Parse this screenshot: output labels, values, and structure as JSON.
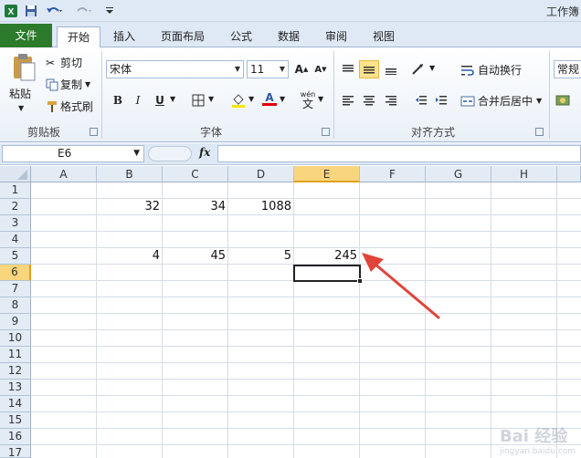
{
  "app": {
    "title": "工作簿"
  },
  "tabs": [
    "文件",
    "开始",
    "插入",
    "页面布局",
    "公式",
    "数据",
    "审阅",
    "视图"
  ],
  "clipboard": {
    "paste": "粘贴",
    "cut": "剪切",
    "copy": "复制",
    "format_painter": "格式刷",
    "group": "剪贴板"
  },
  "font": {
    "name": "宋体",
    "size": "11",
    "bold": "B",
    "italic": "I",
    "underline": "U",
    "wen": "wén",
    "wen_char": "文",
    "font_color_letter": "A",
    "group": "字体"
  },
  "alignment": {
    "wrap_text": "自动换行",
    "merge_center": "合并后居中",
    "group": "对齐方式"
  },
  "number": {
    "format": "常规"
  },
  "formula_bar": {
    "name_box": "E6",
    "fx": "fx",
    "content": ""
  },
  "sheet": {
    "columns": [
      "A",
      "B",
      "C",
      "D",
      "E",
      "F",
      "G",
      "H"
    ],
    "rows": [
      "1",
      "2",
      "3",
      "4",
      "5",
      "6",
      "7",
      "8",
      "9",
      "10",
      "11",
      "12",
      "13",
      "14",
      "15",
      "16",
      "17"
    ],
    "selected_cell": "E6",
    "cells": {
      "B2": "32",
      "C2": "34",
      "D2": "1088",
      "B5": "4",
      "C5": "45",
      "D5": "5",
      "E5": "245"
    }
  },
  "watermark": {
    "main": "Bai 经验",
    "sub": "jingyan.baidu.com"
  },
  "colors": {
    "file_tab": "#2c7b2c",
    "selected_header": "#f9d57d",
    "arrow": "#e0443a"
  }
}
